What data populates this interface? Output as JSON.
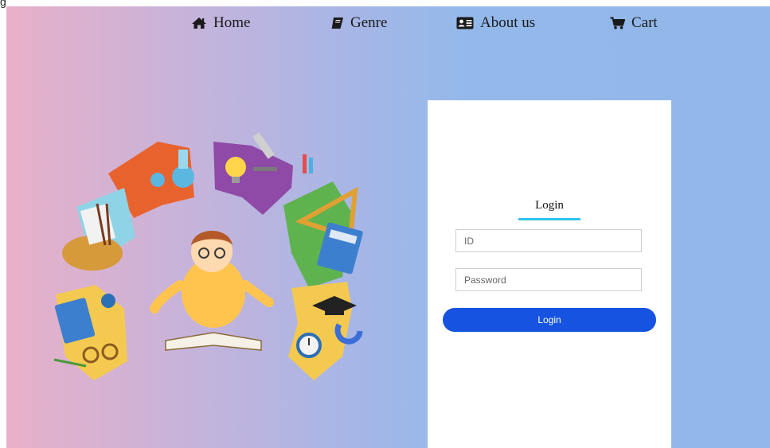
{
  "corner_text": "g",
  "nav": {
    "items": [
      {
        "label": "Home",
        "icon": "home-icon"
      },
      {
        "label": "Genre",
        "icon": "book-icon"
      },
      {
        "label": "About us",
        "icon": "id-card-icon"
      },
      {
        "label": "Cart",
        "icon": "cart-icon"
      }
    ]
  },
  "login": {
    "title": "Login",
    "id_placeholder": "ID",
    "password_placeholder": "Password",
    "button_label": "Login"
  },
  "colors": {
    "accent_underline": "#2ec4ec",
    "button": "#1553e0",
    "gradient_left": "#e8b0c8",
    "gradient_right": "#92b8ea"
  }
}
